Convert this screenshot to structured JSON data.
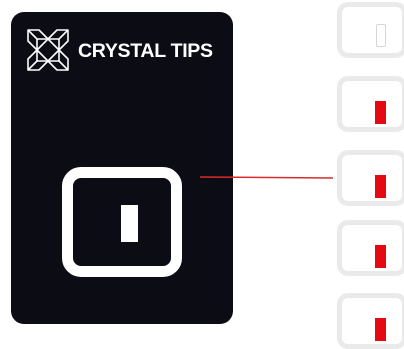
{
  "brand": {
    "name": "CRYSTAL TIPS",
    "logo_icon": "crystal-logo-icon",
    "card_color": "#0b0c14"
  },
  "preview": {
    "indicator_color": "#ffffff",
    "connector_color": "#d92b2b"
  },
  "swatches": [
    {
      "label": "",
      "state": "empty",
      "mark_color": "#d6d6d6"
    },
    {
      "label": "",
      "state": "red",
      "mark_color": "#e50914"
    },
    {
      "label": "",
      "state": "red",
      "mark_color": "#e50914"
    },
    {
      "label": "",
      "state": "red",
      "mark_color": "#e50914"
    },
    {
      "label": "",
      "state": "red",
      "mark_color": "#e50914"
    }
  ]
}
